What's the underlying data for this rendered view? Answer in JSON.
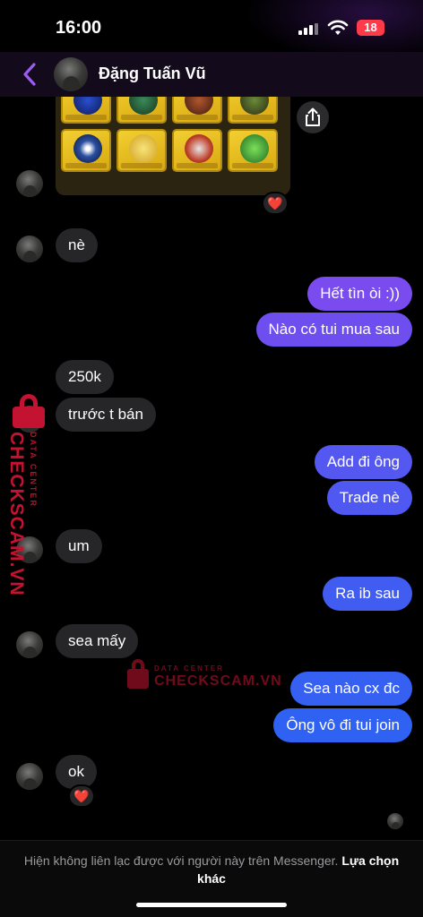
{
  "status_bar": {
    "time": "16:00",
    "battery": "18"
  },
  "header": {
    "contact_name": "Đặng Tuấn Vũ"
  },
  "colors": {
    "out_bubble_top": "#7a4cf0",
    "out_bubble_bottom": "#2f62f2",
    "in_bubble": "#262628",
    "reaction": "#ff3b4a",
    "watermark": "#c41330"
  },
  "icons": {
    "back": "chevron-left-icon",
    "share": "share-icon",
    "reaction": "heart-icon"
  },
  "reactions": {
    "image": "❤️",
    "ok": "❤️"
  },
  "messages": [
    {
      "side": "in",
      "text": "nè"
    },
    {
      "side": "out",
      "text": "Hết tìn òi :))"
    },
    {
      "side": "out",
      "text": "Nào có tui mua sau"
    },
    {
      "side": "in",
      "text": "250k"
    },
    {
      "side": "in",
      "text": "trước t bán"
    },
    {
      "side": "out",
      "text": "Add đi ông"
    },
    {
      "side": "out",
      "text": "Trade nè"
    },
    {
      "side": "in",
      "text": "um"
    },
    {
      "side": "out",
      "text": "Ra ib sau"
    },
    {
      "side": "in",
      "text": "sea mấy"
    },
    {
      "side": "out",
      "text": "Sea nào cx đc"
    },
    {
      "side": "out",
      "text": "Ông vô đi tui join"
    },
    {
      "side": "in",
      "text": "ok"
    }
  ],
  "watermark": {
    "brand": "CHECKSCAM.VN",
    "tagline": "DATA CENTER"
  },
  "footer": {
    "notice": "Hiện không liên lạc được với người này trên Messenger.",
    "link": "Lựa chọn khác"
  }
}
